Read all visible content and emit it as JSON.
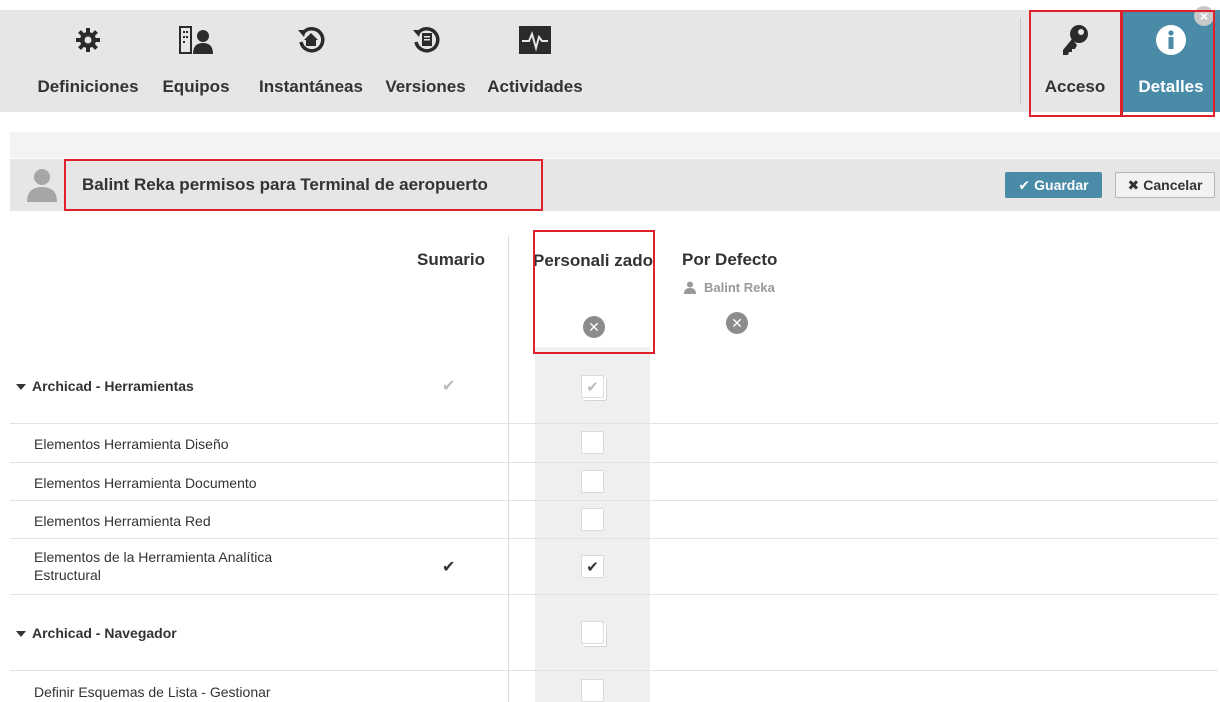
{
  "toolbar": {
    "items": [
      {
        "label": "Definiciones",
        "icon": "gear-icon"
      },
      {
        "label": "Equipos",
        "icon": "team-icon"
      },
      {
        "label": "Instantáneas",
        "icon": "snapshot-icon"
      },
      {
        "label": "Versiones",
        "icon": "versions-icon"
      },
      {
        "label": "Actividades",
        "icon": "activity-icon"
      }
    ],
    "acceso": {
      "label": "Acceso",
      "icon": "key-icon"
    },
    "detalles": {
      "label": "Detalles",
      "icon": "info-icon"
    }
  },
  "header": {
    "title": "Balint Reka permisos para Terminal de aeropuerto",
    "save_label": "Guardar",
    "cancel_label": "Cancelar"
  },
  "columns": {
    "sumario": "Sumario",
    "personalizado": "Personali zado",
    "por_defecto": "Por Defecto",
    "default_user": "Balint Reka"
  },
  "rows": [
    {
      "label": "Archicad - Herramientas",
      "group": true,
      "summary": "✔",
      "checked": true
    },
    {
      "label": "Elementos Herramienta Diseño",
      "group": false,
      "summary": "",
      "checked": false
    },
    {
      "label": "Elementos Herramienta Documento",
      "group": false,
      "summary": "",
      "checked": false
    },
    {
      "label": "Elementos Herramienta Red",
      "group": false,
      "summary": "",
      "checked": false
    },
    {
      "label": "Elementos de la Herramienta Analítica Estructural",
      "group": false,
      "summary": "✔",
      "checked": true
    },
    {
      "label": "Archicad - Navegador",
      "group": true,
      "summary": "",
      "checked": false
    },
    {
      "label": "Definir Esquemas de Lista - Gestionar",
      "group": false,
      "summary": "",
      "checked": false
    }
  ],
  "colors": {
    "accent": "#4a8ba8",
    "highlight": "#e0202a",
    "toolbar_bg": "#e6e6e6"
  }
}
